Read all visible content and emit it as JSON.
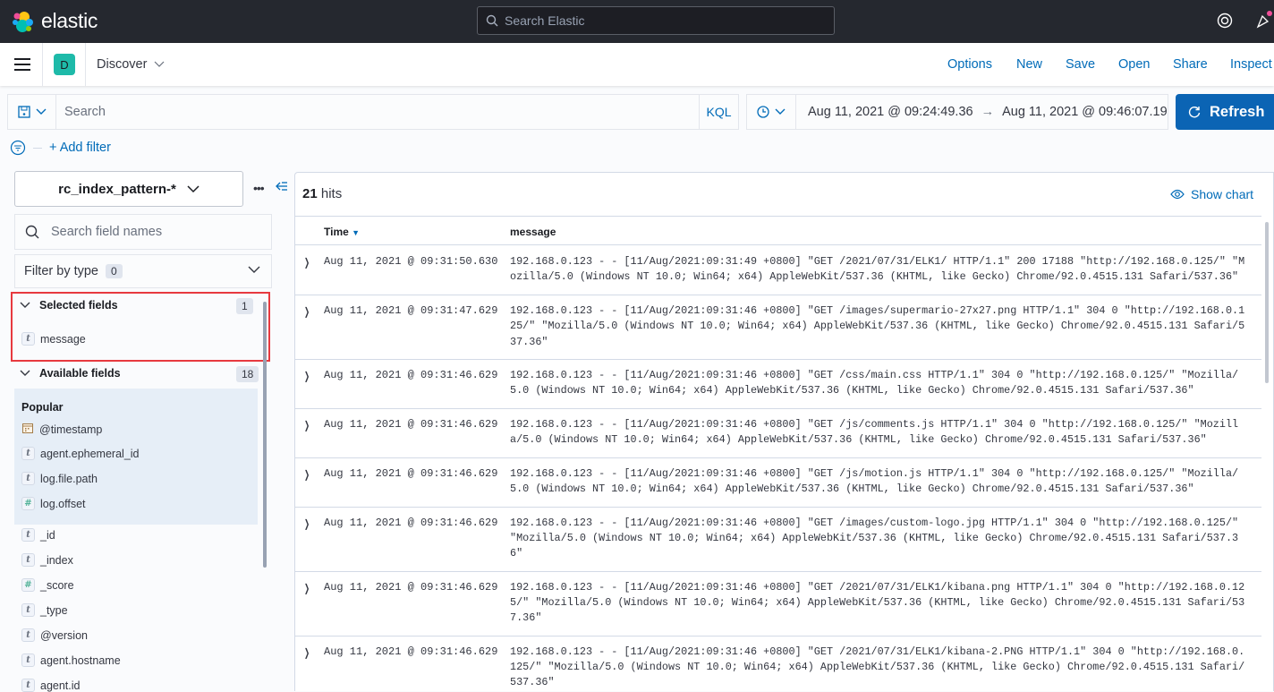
{
  "header": {
    "brand": "elastic",
    "search_placeholder": "Search Elastic"
  },
  "nav": {
    "space_initial": "D",
    "app": "Discover",
    "menu": [
      "Options",
      "New",
      "Save",
      "Open",
      "Share",
      "Inspect"
    ]
  },
  "query": {
    "placeholder": "Search",
    "language": "KQL",
    "start": "Aug 11, 2021 @ 09:24:49.36",
    "arrow": "→",
    "end": "Aug 11, 2021 @ 09:46:07.19",
    "refresh": "Refresh"
  },
  "filters": {
    "add": "+ Add filter"
  },
  "sidebar": {
    "index_pattern": "rc_index_pattern-*",
    "field_search_placeholder": "Search field names",
    "filter_by_type": "Filter by type",
    "filter_count": "0",
    "selected_title": "Selected fields",
    "selected_count": "1",
    "selected": [
      {
        "type": "t",
        "name": "message"
      }
    ],
    "available_title": "Available fields",
    "available_count": "18",
    "popular_title": "Popular",
    "popular": [
      {
        "type": "date",
        "name": "@timestamp"
      },
      {
        "type": "t",
        "name": "agent.ephemeral_id"
      },
      {
        "type": "t",
        "name": "log.file.path"
      },
      {
        "type": "#",
        "name": "log.offset"
      }
    ],
    "fields": [
      {
        "type": "t",
        "name": "_id"
      },
      {
        "type": "t",
        "name": "_index"
      },
      {
        "type": "#",
        "name": "_score"
      },
      {
        "type": "t",
        "name": "_type"
      },
      {
        "type": "t",
        "name": "@version"
      },
      {
        "type": "t",
        "name": "agent.hostname"
      },
      {
        "type": "t",
        "name": "agent.id"
      }
    ]
  },
  "results": {
    "hits_count": "21",
    "hits_label": " hits",
    "show_chart": "Show chart",
    "columns": [
      "Time",
      "message"
    ],
    "rows": [
      {
        "time": "Aug 11, 2021 @ 09:31:50.630",
        "message": "192.168.0.123 - - [11/Aug/2021:09:31:49 +0800] \"GET /2021/07/31/ELK1/ HTTP/1.1\" 200 17188 \"http://192.168.0.125/\" \"Mozilla/5.0 (Windows NT 10.0; Win64; x64) AppleWebKit/537.36 (KHTML, like Gecko) Chrome/92.0.4515.131 Safari/537.36\""
      },
      {
        "time": "Aug 11, 2021 @ 09:31:47.629",
        "message": "192.168.0.123 - - [11/Aug/2021:09:31:46 +0800] \"GET /images/supermario-27x27.png HTTP/1.1\" 304 0 \"http://192.168.0.125/\" \"Mozilla/5.0 (Windows NT 10.0; Win64; x64) AppleWebKit/537.36 (KHTML, like Gecko) Chrome/92.0.4515.131 Safari/537.36\""
      },
      {
        "time": "Aug 11, 2021 @ 09:31:46.629",
        "message": "192.168.0.123 - - [11/Aug/2021:09:31:46 +0800] \"GET /css/main.css HTTP/1.1\" 304 0 \"http://192.168.0.125/\" \"Mozilla/5.0 (Windows NT 10.0; Win64; x64) AppleWebKit/537.36 (KHTML, like Gecko) Chrome/92.0.4515.131 Safari/537.36\""
      },
      {
        "time": "Aug 11, 2021 @ 09:31:46.629",
        "message": "192.168.0.123 - - [11/Aug/2021:09:31:46 +0800] \"GET /js/comments.js HTTP/1.1\" 304 0 \"http://192.168.0.125/\" \"Mozilla/5.0 (Windows NT 10.0; Win64; x64) AppleWebKit/537.36 (KHTML, like Gecko) Chrome/92.0.4515.131 Safari/537.36\""
      },
      {
        "time": "Aug 11, 2021 @ 09:31:46.629",
        "message": "192.168.0.123 - - [11/Aug/2021:09:31:46 +0800] \"GET /js/motion.js HTTP/1.1\" 304 0 \"http://192.168.0.125/\" \"Mozilla/5.0 (Windows NT 10.0; Win64; x64) AppleWebKit/537.36 (KHTML, like Gecko) Chrome/92.0.4515.131 Safari/537.36\""
      },
      {
        "time": "Aug 11, 2021 @ 09:31:46.629",
        "message": "192.168.0.123 - - [11/Aug/2021:09:31:46 +0800] \"GET /images/custom-logo.jpg HTTP/1.1\" 304 0 \"http://192.168.0.125/\" \"Mozilla/5.0 (Windows NT 10.0; Win64; x64) AppleWebKit/537.36 (KHTML, like Gecko) Chrome/92.0.4515.131 Safari/537.36\""
      },
      {
        "time": "Aug 11, 2021 @ 09:31:46.629",
        "message": "192.168.0.123 - - [11/Aug/2021:09:31:46 +0800] \"GET /2021/07/31/ELK1/kibana.png HTTP/1.1\" 304 0 \"http://192.168.0.125/\" \"Mozilla/5.0 (Windows NT 10.0; Win64; x64) AppleWebKit/537.36 (KHTML, like Gecko) Chrome/92.0.4515.131 Safari/537.36\""
      },
      {
        "time": "Aug 11, 2021 @ 09:31:46.629",
        "message": "192.168.0.123 - - [11/Aug/2021:09:31:46 +0800] \"GET /2021/07/31/ELK1/kibana-2.PNG HTTP/1.1\" 304 0 \"http://192.168.0.125/\" \"Mozilla/5.0 (Windows NT 10.0; Win64; x64) AppleWebKit/537.36 (KHTML, like Gecko) Chrome/92.0.4515.131 Safari/537.36\""
      }
    ]
  },
  "colors": {
    "accent": "#006bb8",
    "topbar": "#25282f",
    "refresh": "#0b64b4",
    "highlight": "#e7393f"
  }
}
